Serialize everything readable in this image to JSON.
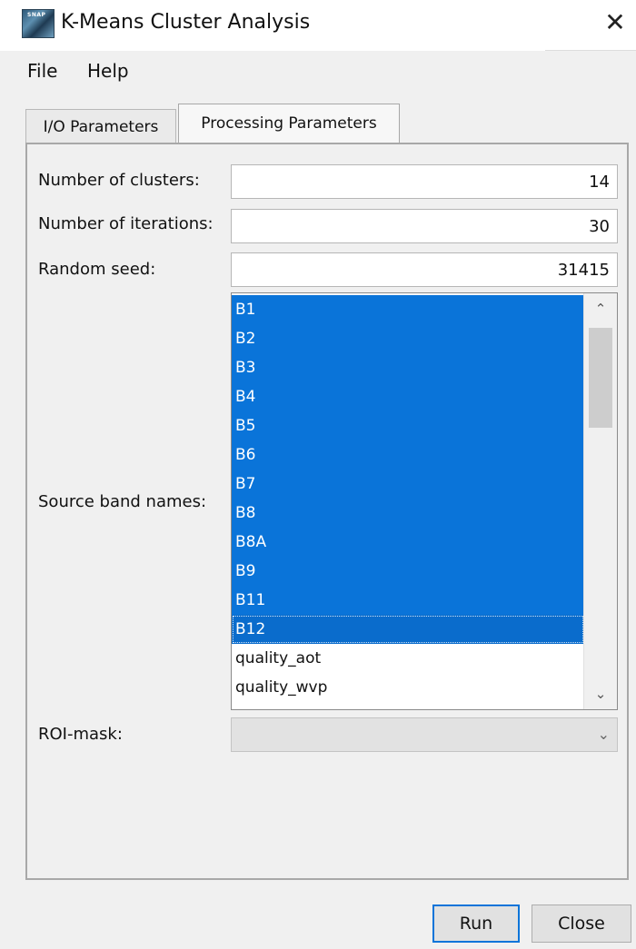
{
  "window": {
    "title": "K-Means Cluster Analysis",
    "icon": "snap-app-icon",
    "icon_text": "SNAP",
    "close_glyph": "✕"
  },
  "menu": {
    "items": [
      "File",
      "Help"
    ]
  },
  "tabs": [
    {
      "label": "I/O Parameters",
      "active": false
    },
    {
      "label": "Processing Parameters",
      "active": true
    }
  ],
  "params": {
    "clusters_label": "Number of clusters:",
    "clusters_value": "14",
    "iterations_label": "Number of iterations:",
    "iterations_value": "30",
    "seed_label": "Random seed:",
    "seed_value": "31415",
    "bands_label": "Source band names:",
    "roi_label": "ROI-mask:",
    "roi_value": ""
  },
  "bands": [
    {
      "name": "B1",
      "selected": true
    },
    {
      "name": "B2",
      "selected": true
    },
    {
      "name": "B3",
      "selected": true
    },
    {
      "name": "B4",
      "selected": true
    },
    {
      "name": "B5",
      "selected": true
    },
    {
      "name": "B6",
      "selected": true
    },
    {
      "name": "B7",
      "selected": true
    },
    {
      "name": "B8",
      "selected": true
    },
    {
      "name": "B8A",
      "selected": true
    },
    {
      "name": "B9",
      "selected": true
    },
    {
      "name": "B11",
      "selected": true
    },
    {
      "name": "B12",
      "selected": true
    },
    {
      "name": "quality_aot",
      "selected": false
    },
    {
      "name": "quality_wvp",
      "selected": false
    }
  ],
  "buttons": {
    "run": "Run",
    "close": "Close"
  },
  "colors": {
    "selection": "#0a74d9",
    "accent_border": "#0a74d9"
  }
}
